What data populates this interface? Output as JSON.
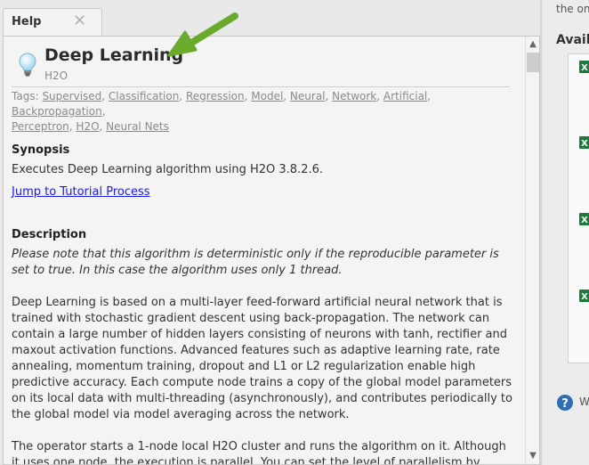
{
  "help_tab": {
    "label": "Help",
    "close_icon": "close-icon"
  },
  "operator": {
    "title": "Deep Learning",
    "subtitle": "H2O",
    "icon": "lightbulb-icon"
  },
  "tags": {
    "label": "Tags:",
    "items": [
      "Supervised",
      "Classification",
      "Regression",
      "Model",
      "Neural",
      "Network",
      "Artificial",
      "Backpropagation",
      "Perceptron",
      "H2O",
      "Neural Nets"
    ]
  },
  "synopsis": {
    "heading": "Synopsis",
    "text": "Executes Deep Learning algorithm using H2O 3.8.2.6.",
    "tutorial_link": "Jump to Tutorial Process"
  },
  "description": {
    "heading": "Description",
    "note": "Please note that this algorithm is deterministic only if the reproducible parameter is set to true. In this case the algorithm uses only 1 thread.",
    "paragraph1": "Deep Learning is based on a multi-layer feed-forward artificial neural network that is trained with stochastic gradient descent using back-propagation. The network can contain a large number of hidden layers consisting of neurons with tanh, rectifier and maxout activation functions. Advanced features such as adaptive learning rate, rate annealing, momentum training, dropout and L1 or L2 regularization enable high predictive accuracy. Each compute node trains a copy of the global model parameters on its local data with multi-threading (asynchronously), and contributes periodically to the global model via model averaging across the network.",
    "paragraph2": "The operator starts a 1-node local H2O cluster and runs the algorithm on it. Although it uses one node, the execution is parallel. You can set the level of parallelism by changing the"
  },
  "right_panel": {
    "top_text": "the on",
    "heading": "Availa",
    "help_text": "W",
    "file_icon": "excel-file-icon",
    "help_icon": "question-circle-icon"
  },
  "colors": {
    "arrow": "#6aab2e",
    "link": "#1a1ae6",
    "excel_green": "#1d7a3f",
    "help_blue": "#2f6db5"
  }
}
